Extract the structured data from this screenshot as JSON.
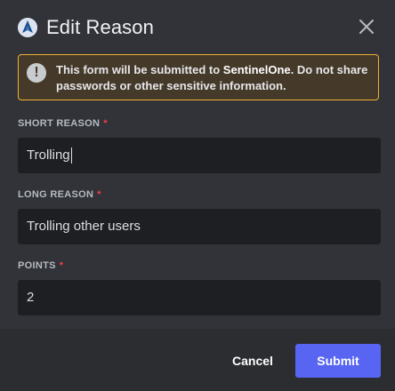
{
  "modal": {
    "title": "Edit Reason",
    "app_icon": "sentinelone-icon",
    "close_icon": "close-icon"
  },
  "notice": {
    "icon": "exclamation-icon",
    "text_prefix": "This form will be submitted to ",
    "text_app": "SentinelOne",
    "text_suffix": ". Do not share passwords or other sensitive information."
  },
  "fields": {
    "short_reason": {
      "label": "SHORT REASON",
      "required_mark": "*",
      "value": "Trolling"
    },
    "long_reason": {
      "label": "LONG REASON",
      "required_mark": "*",
      "value": "Trolling other users"
    },
    "points": {
      "label": "POINTS",
      "required_mark": "*",
      "value": "2"
    }
  },
  "footer": {
    "cancel_label": "Cancel",
    "submit_label": "Submit"
  },
  "colors": {
    "background": "#313338",
    "footer": "#2b2d31",
    "input": "#1e1f22",
    "notice_border": "#f0b232",
    "required": "#f23f43",
    "primary": "#5865f2"
  }
}
